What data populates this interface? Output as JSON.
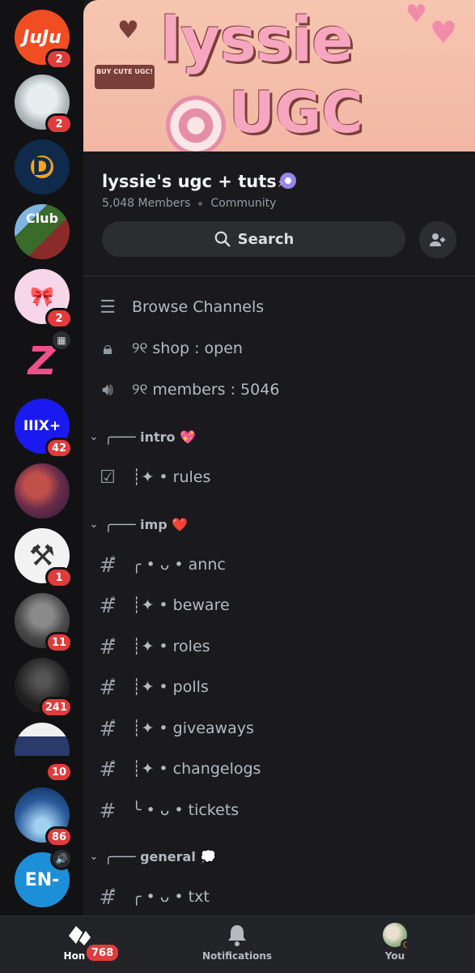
{
  "servers": [
    {
      "name": "juju",
      "text": "JuJu",
      "badge": "2",
      "bg": "#f04d23",
      "fg": "#ffffff"
    },
    {
      "name": "seal",
      "text": "",
      "badge": "2",
      "bg": "#cfd6d8",
      "fg": "#333333"
    },
    {
      "name": "fox",
      "text": "D",
      "badge": "",
      "bg": "#0f2a4a",
      "fg": "#f5a623"
    },
    {
      "name": "club",
      "text": "Club",
      "badge": "",
      "bg": "#3a6b2a",
      "fg": "#ffffff"
    },
    {
      "name": "bow",
      "text": "",
      "badge": "2",
      "bg": "#f7d6ea",
      "fg": "#222222"
    },
    {
      "name": "z-logo",
      "text": "Z",
      "badge": "",
      "bg": "#121214",
      "fg": "#f0508a",
      "top_icon": "event"
    },
    {
      "name": "blue",
      "text": "IIIX+",
      "badge": "42",
      "bg": "#1a1af0",
      "fg": "#ffffff"
    },
    {
      "name": "art",
      "text": "",
      "badge": "",
      "bg": "#6a2d4a",
      "fg": "#ffffff"
    },
    {
      "name": "tools",
      "text": "⚒",
      "badge": "1",
      "bg": "#f2f2f2",
      "fg": "#333333"
    },
    {
      "name": "dog",
      "text": "",
      "badge": "11",
      "bg": "#4a4a4a",
      "fg": "#ffffff"
    },
    {
      "name": "dark",
      "text": "",
      "badge": "241",
      "bg": "#1e1e1e",
      "fg": "#ffffff"
    },
    {
      "name": "roblox",
      "text": "",
      "badge": "10",
      "bg": "#2a3a6a",
      "fg": "#ffffff"
    },
    {
      "name": "underwater",
      "text": "",
      "badge": "86",
      "bg": "#2a5a9a",
      "fg": "#ffffff"
    },
    {
      "name": "enhypen",
      "text": "EN-",
      "badge": "",
      "bg": "#1d8ed8",
      "fg": "#ffffff",
      "top_icon": "speaker"
    }
  ],
  "banner": {
    "line1": "lyssie",
    "line2": "UGC",
    "sign": "BUY CUTE UGC!"
  },
  "header": {
    "title": "lyssie's ugc + tuts",
    "members": "5,048 Members",
    "type": "Community"
  },
  "search": {
    "label": "Search"
  },
  "top_rows": [
    {
      "icon": "browse-icon",
      "label": "Browse Channels"
    },
    {
      "icon": "lock-icon",
      "label": "୨୧ shop : open"
    },
    {
      "icon": "voice-lock-icon",
      "label": "୨୧ members : 5046"
    }
  ],
  "categories": {
    "intro": {
      "label": "╭─── intro 💖",
      "rows": [
        {
          "label": "┊✦ • rules"
        }
      ]
    },
    "imp": {
      "label": "╭─── imp ❤️",
      "rows": [
        {
          "label": "╭ • ᴗ • annc"
        },
        {
          "label": "┊✦ • beware"
        },
        {
          "label": "┊✦ • roles"
        },
        {
          "label": "┊✦ • polls"
        },
        {
          "label": "┊✦ • giveaways"
        },
        {
          "label": "┊✦ • changelogs"
        },
        {
          "label": "╰ • ᴗ • tickets"
        }
      ]
    },
    "general": {
      "label": "╭─── general 💭",
      "rows": [
        {
          "label": "╭ • ᴗ • txt"
        }
      ]
    }
  },
  "nav": {
    "home": "Home",
    "home_badge": "768",
    "notifications": "Notifications",
    "you": "You"
  },
  "colors": {
    "accent": "#5865f2",
    "badge": "#e13c3c",
    "background": "#1a1a1e",
    "rail": "#121214"
  }
}
